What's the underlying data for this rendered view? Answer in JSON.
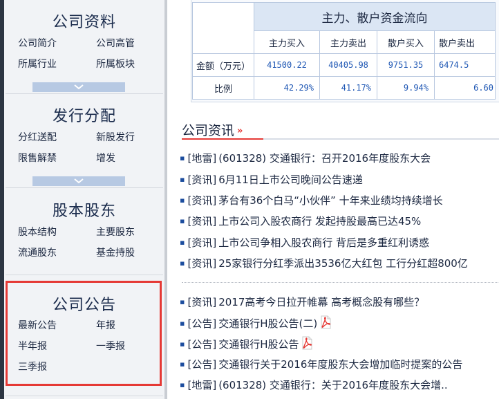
{
  "sidebar": {
    "sections": [
      {
        "title": "公司资料",
        "links": [
          "公司简介",
          "公司高管",
          "所属行业",
          "所属板块"
        ]
      },
      {
        "title": "发行分配",
        "links": [
          "分红送配",
          "新股发行",
          "限售解禁",
          "增发"
        ]
      },
      {
        "title": "股本股东",
        "links": [
          "股本结构",
          "主要股东",
          "流通股东",
          "基金持股"
        ]
      },
      {
        "title": "公司公告",
        "links": [
          "最新公告",
          "年报",
          "半年报",
          "一季报",
          "三季报"
        ]
      }
    ]
  },
  "fund_flow": {
    "caption": "主力、散户资金流向",
    "columns": [
      "主力买入",
      "主力卖出",
      "散户买入",
      "散户卖出"
    ],
    "rows": [
      {
        "label": "金额（万元）",
        "values": [
          "41500.22",
          "40405.98",
          "9751.35",
          "6474.5"
        ]
      },
      {
        "label": "比例",
        "values": [
          "42.29%",
          "41.17%",
          "9.94%",
          "6.60"
        ]
      }
    ]
  },
  "news": {
    "title": "公司资讯",
    "arrows": "»",
    "items": [
      {
        "tag": "[地雷]",
        "text": "(601328) 交通银行：召开2016年度股东大会",
        "pdf": false
      },
      {
        "tag": "[资讯]",
        "text": "6月11日上市公司晚间公告速递",
        "pdf": false
      },
      {
        "tag": "[资讯]",
        "text": "茅台有36个白马“小伙伴” 十年来业绩均持续增长",
        "pdf": false
      },
      {
        "tag": "[资讯]",
        "text": "上市公司入股农商行 发起持股最高已达45%",
        "pdf": false
      },
      {
        "tag": "[资讯]",
        "text": "上市公司争相入股农商行 背后是多重红利诱惑",
        "pdf": false
      },
      {
        "tag": "[资讯]",
        "text": "25家银行分红季派出3536亿大红包 工行分红超800亿",
        "pdf": false
      },
      {
        "tag": "[资讯]",
        "text": "2017高考今日拉开帷幕 高考概念股有哪些？",
        "pdf": false
      },
      {
        "tag": "[公告]",
        "text": "交通银行H股公告(二)",
        "pdf": true
      },
      {
        "tag": "[公告]",
        "text": "交通银行H股公告",
        "pdf": true
      },
      {
        "tag": "[公告]",
        "text": "交通银行关于2016年度股东大会增加临时提案的公告",
        "pdf": false
      },
      {
        "tag": "[地雷]",
        "text": "(601328) 交通银行：关于2016年度股东大会增..",
        "pdf": false
      }
    ]
  },
  "colors": {
    "accent": "#e53935",
    "link": "#1c55b3",
    "header_bg": "#dbe6f4",
    "expand_bar": "#b7c9e3"
  }
}
